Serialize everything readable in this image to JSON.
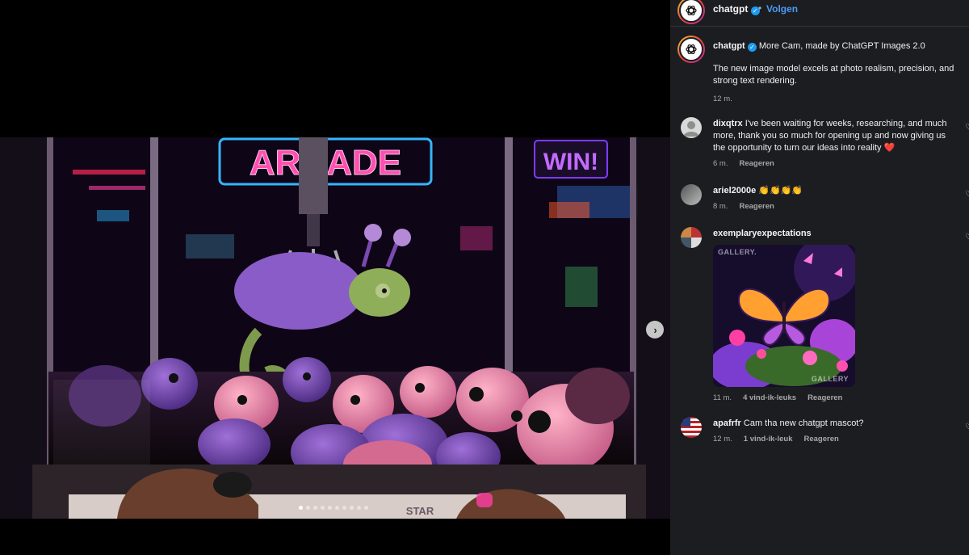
{
  "post_header": {
    "username": "chatgpt",
    "separator": "•",
    "follow_label": "Volgen"
  },
  "caption": {
    "username": "chatgpt",
    "title": "More Cam, made by ChatGPT Images 2.0",
    "text": "The new image model excels at photo realism, precision, and strong text rendering.",
    "time": "12 m."
  },
  "photo": {
    "sign_arcade": "ARCADE",
    "sign_win": "WIN!",
    "machine_label": "STAR",
    "carousel_count": 10,
    "carousel_active": 1
  },
  "comments": [
    {
      "username": "dixqtrx",
      "text": "I've been waiting for weeks, researching, and much more, thank you so much for opening up and now giving us the opportunity to turn our ideas into reality ❤️",
      "time": "6 m.",
      "reply_label": "Reageren"
    },
    {
      "username": "ariel2000e",
      "text": "👏👏👏👏",
      "time": "8 m.",
      "reply_label": "Reageren"
    },
    {
      "username": "exemplaryexpectations",
      "image_watermark_top": "GALLERY.",
      "image_watermark_bottom": "GALLERY",
      "time": "11 m.",
      "likes": "4 vind-ik-leuks",
      "reply_label": "Reageren"
    },
    {
      "username": "apafrfr",
      "text": "Cam tha new chatgpt mascot?",
      "time": "12 m.",
      "likes": "1 vind-ik-leuk",
      "reply_label": "Reageren"
    }
  ],
  "colors": {
    "panel_bg": "#1c1d21",
    "link_blue": "#4a9bf5",
    "verified_blue": "#1d9bf0",
    "neon_pink": "#ff3fa4",
    "neon_purple": "#b84dff"
  }
}
